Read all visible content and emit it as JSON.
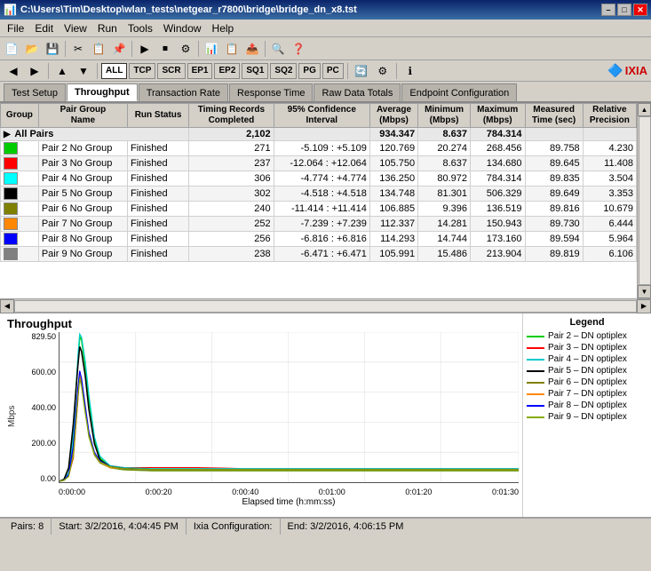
{
  "window": {
    "title": "C:\\Users\\Tim\\Desktop\\wlan_tests\\netgear_r7800\\bridge\\bridge_dn_x8.tst",
    "icon": "📊"
  },
  "menus": [
    "File",
    "Edit",
    "View",
    "Run",
    "Tools",
    "Window",
    "Help"
  ],
  "proto_buttons": [
    "ALL",
    "TCP",
    "SCR",
    "EP1",
    "EP2",
    "SQ1",
    "SQ2",
    "PG",
    "PC"
  ],
  "tabs": [
    "Test Setup",
    "Throughput",
    "Transaction Rate",
    "Response Time",
    "Raw Data Totals",
    "Endpoint Configuration"
  ],
  "active_tab": "Throughput",
  "table": {
    "headers": [
      {
        "label": "Group",
        "rowspan": 2
      },
      {
        "label": "Pair Group Name",
        "rowspan": 2
      },
      {
        "label": "Run Status",
        "rowspan": 2
      },
      {
        "label": "Timing Records Completed",
        "rowspan": 2
      },
      {
        "label": "95% Confidence Interval",
        "rowspan": 2
      },
      {
        "label": "Average (Mbps)",
        "rowspan": 2
      },
      {
        "label": "Minimum (Mbps)",
        "rowspan": 2
      },
      {
        "label": "Maximum (Mbps)",
        "rowspan": 2
      },
      {
        "label": "Measured Time (sec)",
        "rowspan": 2
      },
      {
        "label": "Relative Precision",
        "rowspan": 2
      }
    ],
    "all_pairs": {
      "records": "2,102",
      "average": "934.347",
      "minimum": "8.637",
      "maximum": "784.314"
    },
    "rows": [
      {
        "pair": "Pair 2",
        "group": "No Group",
        "status": "Finished",
        "color": 0,
        "records": "271",
        "ci": "-5.109 : +5.109",
        "avg": "120.769",
        "min": "20.274",
        "max": "268.456",
        "time": "89.758",
        "rp": "4.230"
      },
      {
        "pair": "Pair 3",
        "group": "No Group",
        "status": "Finished",
        "color": 1,
        "records": "237",
        "ci": "-12.064 : +12.064",
        "avg": "105.750",
        "min": "8.637",
        "max": "134.680",
        "time": "89.645",
        "rp": "11.408"
      },
      {
        "pair": "Pair 4",
        "group": "No Group",
        "status": "Finished",
        "color": 2,
        "records": "306",
        "ci": "-4.774 : +4.774",
        "avg": "136.250",
        "min": "80.972",
        "max": "784.314",
        "time": "89.835",
        "rp": "3.504"
      },
      {
        "pair": "Pair 5",
        "group": "No Group",
        "status": "Finished",
        "color": 3,
        "records": "302",
        "ci": "-4.518 : +4.518",
        "avg": "134.748",
        "min": "81.301",
        "max": "506.329",
        "time": "89.649",
        "rp": "3.353"
      },
      {
        "pair": "Pair 6",
        "group": "No Group",
        "status": "Finished",
        "color": 4,
        "records": "240",
        "ci": "-11.414 : +11.414",
        "avg": "106.885",
        "min": "9.396",
        "max": "136.519",
        "time": "89.816",
        "rp": "10.679"
      },
      {
        "pair": "Pair 7",
        "group": "No Group",
        "status": "Finished",
        "color": 5,
        "records": "252",
        "ci": "-7.239 : +7.239",
        "avg": "112.337",
        "min": "14.281",
        "max": "150.943",
        "time": "89.730",
        "rp": "6.444"
      },
      {
        "pair": "Pair 8",
        "group": "No Group",
        "status": "Finished",
        "color": 6,
        "records": "256",
        "ci": "-6.816 : +6.816",
        "avg": "114.293",
        "min": "14.744",
        "max": "173.160",
        "time": "89.594",
        "rp": "5.964"
      },
      {
        "pair": "Pair 9",
        "group": "No Group",
        "status": "Finished",
        "color": 7,
        "records": "238",
        "ci": "-6.471 : +6.471",
        "avg": "105.991",
        "min": "15.486",
        "max": "213.904",
        "time": "89.819",
        "rp": "6.106"
      }
    ]
  },
  "chart": {
    "title": "Throughput",
    "y_label": "Mbps",
    "y_max": "829.50",
    "y_ticks": [
      "829.50",
      "600.00",
      "400.00",
      "200.00",
      "0.00"
    ],
    "x_label": "Elapsed time (h:mm:ss)",
    "x_ticks": [
      "0:00:00",
      "0:00:20",
      "0:00:40",
      "0:01:00",
      "0:01:20",
      "0:01:30"
    ]
  },
  "legend": {
    "title": "Legend",
    "items": [
      {
        "label": "Pair 2 – DN optiplex",
        "color": "#00cc00"
      },
      {
        "label": "Pair 3 – DN optiplex",
        "color": "#ff0000"
      },
      {
        "label": "Pair 4 – DN optiplex",
        "color": "#00cccc"
      },
      {
        "label": "Pair 5 – DN optiplex",
        "color": "#000000"
      },
      {
        "label": "Pair 6 – DN optiplex",
        "color": "#808000"
      },
      {
        "label": "Pair 7 – DN optiplex",
        "color": "#ff8800"
      },
      {
        "label": "Pair 8 – DN optiplex",
        "color": "#0000ff"
      },
      {
        "label": "Pair 9 – DN optiplex",
        "color": "#88aa00"
      }
    ]
  },
  "status_bar": {
    "pairs": "Pairs: 8",
    "start": "Start: 3/2/2016, 4:04:45 PM",
    "ixia": "Ixia Configuration:",
    "end": "End: 3/2/2016, 4:06:15 PM"
  }
}
